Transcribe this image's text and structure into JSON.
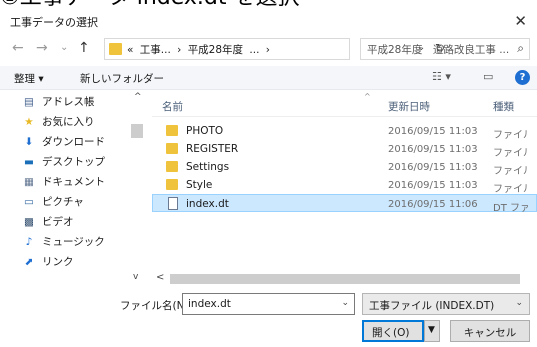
{
  "banner": {
    "text": "①工事データ index.dt を選択"
  },
  "window": {
    "title": "工事データの選択",
    "close_glyph": "✕"
  },
  "nav": {
    "back": "←",
    "forward": "→",
    "recent": "⌄",
    "up": "↑"
  },
  "address": {
    "crumbs": [
      "«",
      "工事...",
      "›",
      "平成28年度",
      "...",
      "›"
    ],
    "dropdown": "⌄",
    "refresh": "↻"
  },
  "search": {
    "placeholder": "平成28年度　道路改良工事 ...",
    "icon": "⌕"
  },
  "toolbar": {
    "organize": "整理 ▾",
    "new_folder": "新しいフォルダー",
    "view": "☷ ▾",
    "pane": "▭",
    "help": "?"
  },
  "sidebar": {
    "scroll_up": "^",
    "scroll_down": "v",
    "items": [
      {
        "label": "アドレス帳",
        "icon": "▤"
      },
      {
        "label": "お気に入り",
        "icon": "★"
      },
      {
        "label": "ダウンロード",
        "icon": "⬇"
      },
      {
        "label": "デスクトップ",
        "icon": "▬"
      },
      {
        "label": "ドキュメント",
        "icon": "▦"
      },
      {
        "label": "ピクチャ",
        "icon": "▭"
      },
      {
        "label": "ビデオ",
        "icon": "▩"
      },
      {
        "label": "ミュージック",
        "icon": "♪"
      },
      {
        "label": "リンク",
        "icon": "⬈"
      }
    ]
  },
  "columns": {
    "name": "名前",
    "modified": "更新日時",
    "type": "種類",
    "sort_glyph": "^"
  },
  "files": [
    {
      "name": "PHOTO",
      "modified": "2016/09/15 11:03",
      "type": "ファイル フォルダー",
      "kind": "folder"
    },
    {
      "name": "REGISTER",
      "modified": "2016/09/15 11:03",
      "type": "ファイル フォルダー",
      "kind": "folder"
    },
    {
      "name": "Settings",
      "modified": "2016/09/15 11:03",
      "type": "ファイル フォルダー",
      "kind": "folder"
    },
    {
      "name": "Style",
      "modified": "2016/09/15 11:03",
      "type": "ファイル フォルダー",
      "kind": "folder"
    },
    {
      "name": "index.dt",
      "modified": "2016/09/15 11:06",
      "type": "DT ファイル",
      "kind": "file",
      "selected": true
    }
  ],
  "hscroll": {
    "left": "<"
  },
  "footer": {
    "filename_label": "ファイル名(N):",
    "filename_value": "index.dt",
    "filename_dropdown": "⌄",
    "filetype_value": "工事ファイル (INDEX.DT)",
    "filetype_dropdown": "⌄",
    "open_label": "開く(O)",
    "open_split": "▼",
    "cancel_label": "キャンセル"
  },
  "colors": {
    "selection": "#cce8ff",
    "folder": "#f0c33c",
    "accent": "#0078d7"
  }
}
